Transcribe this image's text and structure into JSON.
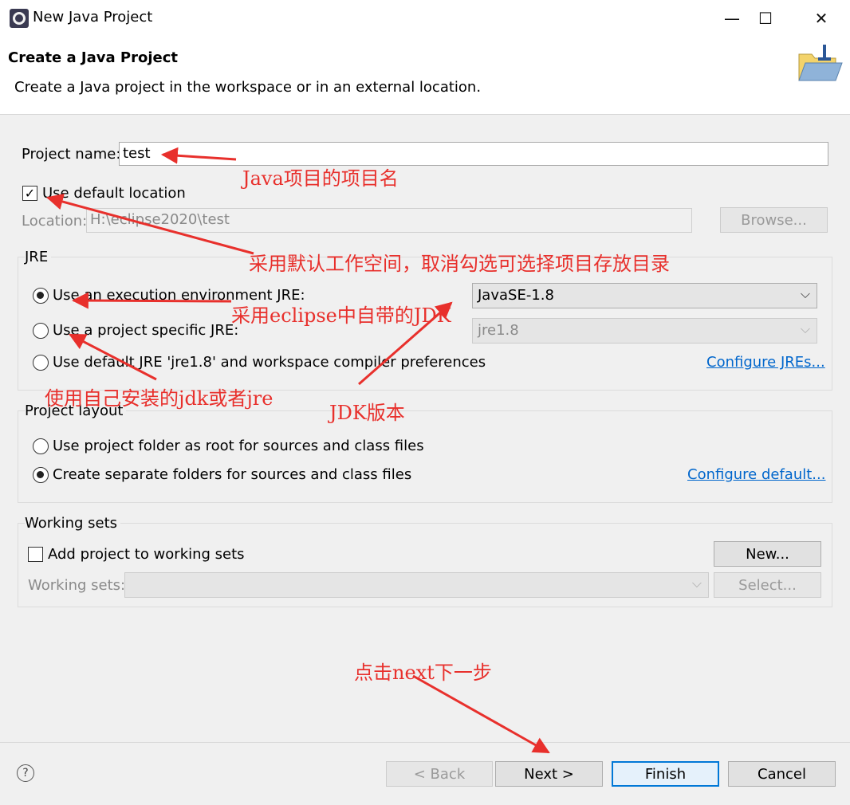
{
  "window": {
    "title": "New Java Project",
    "minimize_glyph": "—",
    "maximize_glyph": "☐",
    "close_glyph": "✕"
  },
  "header": {
    "title": "Create a Java Project",
    "description": "Create a Java project in the workspace or in an external location."
  },
  "project": {
    "name_label": "Project name:",
    "name_value": "test",
    "use_default_location_label": "Use default location",
    "use_default_location_checked": true,
    "location_label": "Location:",
    "location_value": "H:\\eclipse2020\\test",
    "browse_label": "Browse..."
  },
  "jre": {
    "title": "JRE",
    "option_execution_env": "Use an execution environment JRE:",
    "option_project_specific": "Use a project specific JRE:",
    "option_default": "Use default JRE 'jre1.8' and workspace compiler preferences",
    "selected": "execution_env",
    "execution_env_value": "JavaSE-1.8",
    "project_specific_value": "jre1.8",
    "configure_link": "Configure JREs..."
  },
  "layout": {
    "title": "Project layout",
    "option_root": "Use project folder as root for sources and class files",
    "option_separate": "Create separate folders for sources and class files",
    "selected": "separate",
    "configure_link": "Configure default..."
  },
  "working_sets": {
    "title": "Working sets",
    "add_label": "Add project to working sets",
    "add_checked": false,
    "new_label": "New...",
    "sets_label": "Working sets:",
    "select_label": "Select..."
  },
  "footer": {
    "back_label": "< Back",
    "next_label": "Next >",
    "finish_label": "Finish",
    "cancel_label": "Cancel",
    "help_glyph": "?"
  },
  "annotations": {
    "project_name": "Java项目的项目名",
    "default_location": "采用默认工作空间，取消勾选可选择项目存放目录",
    "eclipse_jdk": "采用eclipse中自带的JDK",
    "own_jdk": "使用自己安装的jdk或者jre",
    "jdk_version": "JDK版本",
    "next_step": "点击next下一步"
  },
  "colors": {
    "annotation": "#e8302c",
    "link": "#0066cc",
    "dialog_bg": "#f0f0f0"
  }
}
